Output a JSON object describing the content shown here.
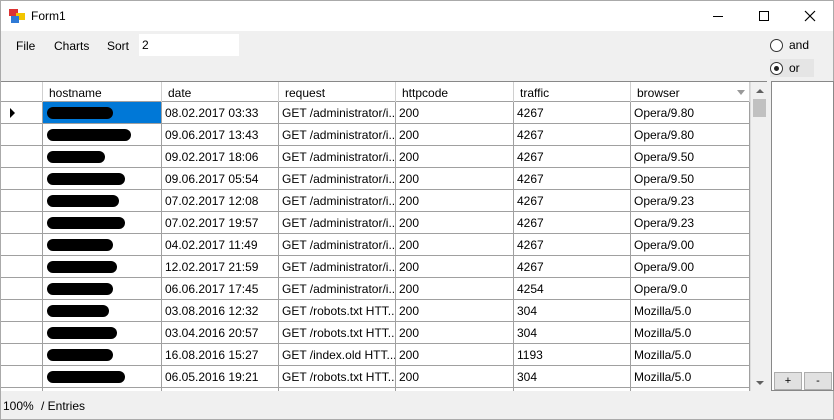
{
  "window": {
    "title": "Form1"
  },
  "menu": {
    "file": "File",
    "charts": "Charts",
    "sort": "Sort",
    "sort_value": "2"
  },
  "filter": {
    "and_label": "and",
    "or_label": "or",
    "selected": "or"
  },
  "grid": {
    "columns": [
      "hostname",
      "date",
      "request",
      "httpcode",
      "traffic",
      "browser"
    ],
    "rows": [
      [
        "",
        "08.02.2017 03:33",
        "GET /administrator/i...",
        "200",
        "4267",
        "Opera/9.80"
      ],
      [
        "",
        "09.06.2017 13:43",
        "GET /administrator/i...",
        "200",
        "4267",
        "Opera/9.80"
      ],
      [
        "",
        "09.02.2017 18:06",
        "GET /administrator/i...",
        "200",
        "4267",
        "Opera/9.50"
      ],
      [
        "",
        "09.06.2017 05:54",
        "GET /administrator/i...",
        "200",
        "4267",
        "Opera/9.50"
      ],
      [
        "",
        "07.02.2017 12:08",
        "GET /administrator/i...",
        "200",
        "4267",
        "Opera/9.23"
      ],
      [
        "",
        "07.02.2017 19:57",
        "GET /administrator/i...",
        "200",
        "4267",
        "Opera/9.23"
      ],
      [
        "",
        "04.02.2017 11:49",
        "GET /administrator/i...",
        "200",
        "4267",
        "Opera/9.00"
      ],
      [
        "",
        "12.02.2017 21:59",
        "GET /administrator/i...",
        "200",
        "4267",
        "Opera/9.00"
      ],
      [
        "",
        "06.06.2017 17:45",
        "GET /administrator/i...",
        "200",
        "4254",
        "Opera/9.0"
      ],
      [
        "",
        "03.08.2016 12:32",
        "GET /robots.txt HTT...",
        "200",
        "304",
        "Mozilla/5.0"
      ],
      [
        "",
        "03.04.2016 20:57",
        "GET /robots.txt HTT...",
        "200",
        "304",
        "Mozilla/5.0"
      ],
      [
        "",
        "16.08.2016 15:27",
        "GET /index.old HTT...",
        "200",
        "1193",
        "Mozilla/5.0"
      ],
      [
        "",
        "06.05.2016 19:21",
        "GET /robots.txt HTT...",
        "200",
        "304",
        "Mozilla/5.0"
      ],
      [
        "",
        "",
        "",
        "",
        "",
        ""
      ]
    ]
  },
  "side": {
    "plus": "+",
    "minus": "-"
  },
  "status": {
    "zoom": "100%",
    "entries": "/ Entries"
  }
}
